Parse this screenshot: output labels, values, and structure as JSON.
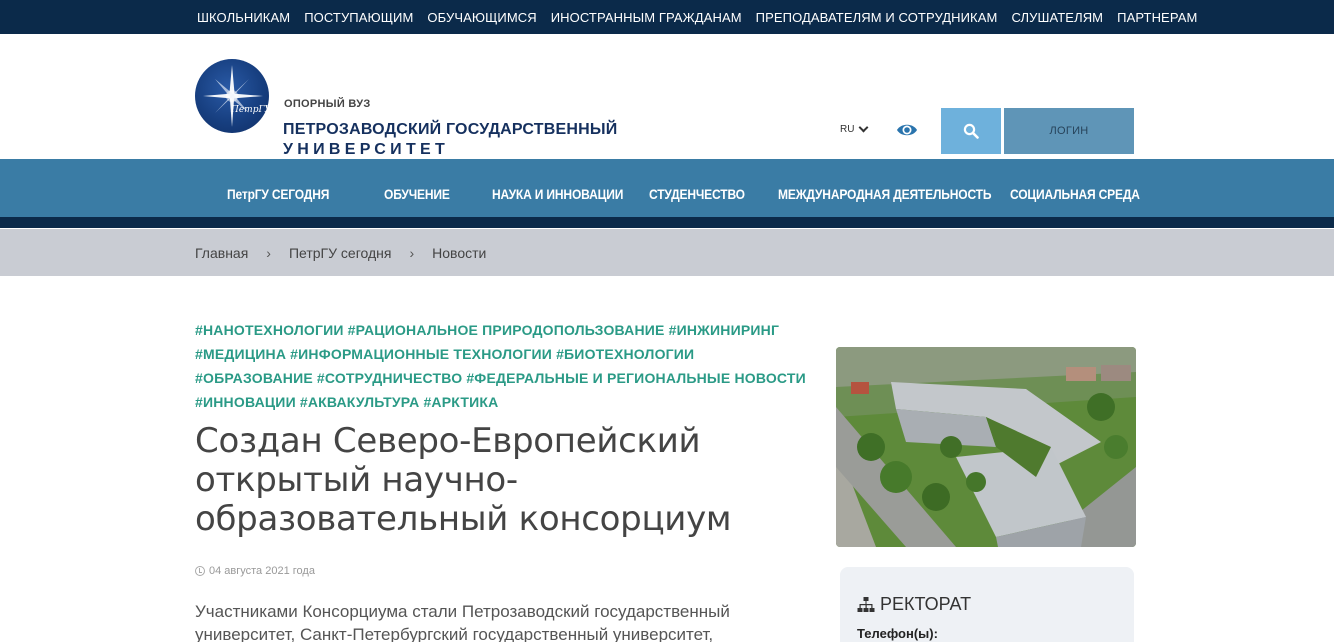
{
  "topbar": {
    "links": [
      "ШКОЛЬНИКАМ",
      "ПОСТУПАЮЩИМ",
      "ОБУЧАЮЩИМСЯ",
      "ИНОСТРАННЫМ ГРАЖДАНАМ",
      "ПРЕПОДАВАТЕЛЯМ И СОТРУДНИКАМ",
      "СЛУШАТЕЛЯМ",
      "ПАРТНЕРАМ"
    ]
  },
  "header": {
    "logo_emblem_text": "ПетрГУ",
    "logo_small": "ОПОРНЫЙ ВУЗ",
    "logo_line1": "ПЕТРОЗАВОДСКИЙ ГОСУДАРСТВЕННЫЙ",
    "logo_line2": "УНИВЕРСИТЕТ",
    "lang": "RU",
    "login": "ЛОГИН",
    "icons": {
      "lang": "chevron-down-icon",
      "accessibility": "eye-icon",
      "search": "search-icon"
    }
  },
  "nav": {
    "items": [
      "ПетрГУ СЕГОДНЯ",
      "ОБУЧЕНИЕ",
      "НАУКА И ИННОВАЦИИ",
      "СТУДЕНЧЕСТВО",
      "МЕЖДУНАРОДНАЯ ДЕЯТЕЛЬНОСТЬ",
      "СОЦИАЛЬНАЯ СРЕДА"
    ]
  },
  "breadcrumb": {
    "items": [
      "Главная",
      "ПетрГУ сегодня",
      "Новости"
    ],
    "separator": "›"
  },
  "article": {
    "tags": [
      "#НАНОТЕХНОЛОГИИ",
      "#РАЦИОНАЛЬНОЕ ПРИРОДОПОЛЬЗОВАНИЕ",
      "#ИНЖИНИРИНГ",
      "#МЕДИЦИНА",
      "#ИНФОРМАЦИОННЫЕ ТЕХНОЛОГИИ",
      "#БИОТЕХНОЛОГИИ",
      "#ОБРАЗОВАНИЕ",
      "#СОТРУДНИЧЕСТВО",
      "#ФЕДЕРАЛЬНЫЕ И РЕГИОНАЛЬНЫЕ НОВОСТИ",
      "#ИННОВАЦИИ",
      "#АКВАКУЛЬТУРА",
      "#АРКТИКА"
    ],
    "title": "Создан Северо-Европейский открытый научно-образовательный консорциум",
    "date": "04 августа 2021 года",
    "lead": "Участниками Консорциума стали Петрозаводский государственный университет, Санкт-Петербургский государственный университет,"
  },
  "sidebar": {
    "rector_title": "РЕКТОРАТ",
    "phone_label": "Телефон(ы):"
  },
  "colors": {
    "topbar": "#0b2a4a",
    "nav": "#3a7ca5",
    "breadcrumb": "#c9ccd3",
    "tag": "#2a9a86",
    "search_button": "#6eb1dc",
    "login_button": "#5f95b7"
  }
}
